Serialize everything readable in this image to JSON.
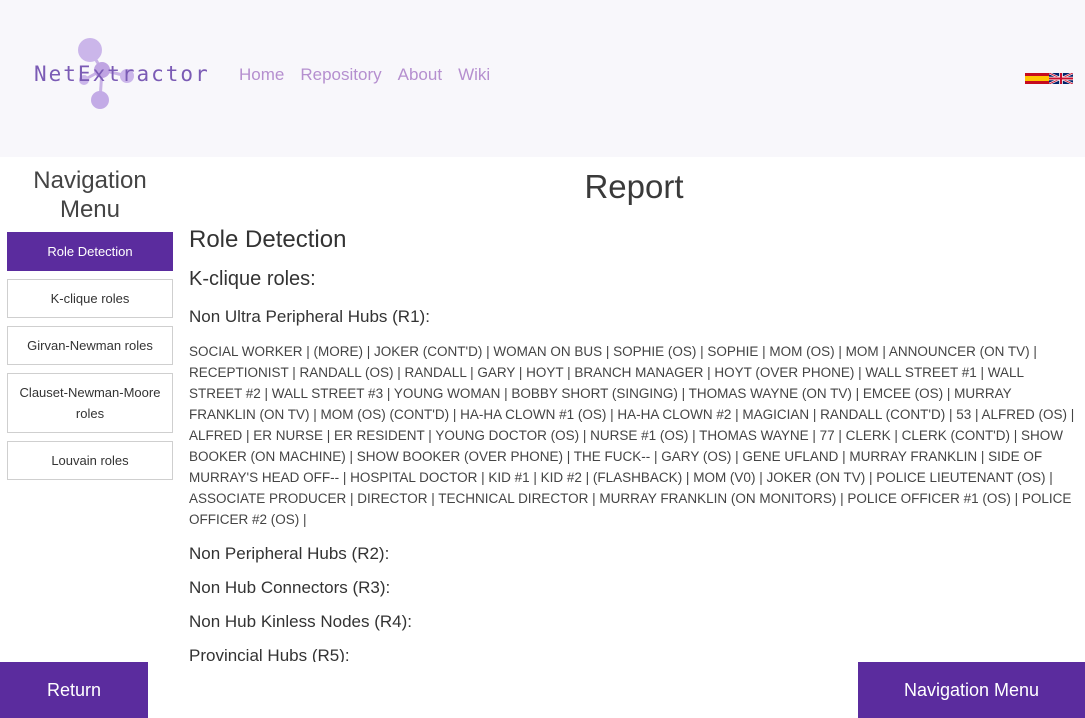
{
  "brand": {
    "name": "NetExtractor"
  },
  "nav": {
    "home": "Home",
    "repository": "Repository",
    "about": "About",
    "wiki": "Wiki"
  },
  "sidebar": {
    "title": "Navigation Menu",
    "items": [
      {
        "label": "Role Detection"
      },
      {
        "label": "K-clique roles"
      },
      {
        "label": "Girvan-Newman roles"
      },
      {
        "label": "Clauset-Newman-Moore roles"
      },
      {
        "label": "Louvain roles"
      }
    ]
  },
  "main": {
    "title": "Report",
    "section": "Role Detection",
    "subsection": "K-clique roles:",
    "roles": [
      {
        "heading": "Non Ultra Peripheral Hubs (R1):",
        "names": "SOCIAL WORKER | (MORE) | JOKER (CONT'D) | WOMAN ON BUS | SOPHIE (OS) | SOPHIE | MOM (OS) | MOM | ANNOUNCER (ON TV) | RECEPTIONIST | RANDALL (OS) | RANDALL | GARY | HOYT | BRANCH MANAGER | HOYT (OVER PHONE) | WALL STREET #1 | WALL STREET #2 | WALL STREET #3 | YOUNG WOMAN | BOBBY SHORT (SINGING) | THOMAS WAYNE (ON TV) | EMCEE (OS) | MURRAY FRANKLIN (ON TV) | MOM (OS) (CONT'D) | HA-HA CLOWN #1 (OS) | HA-HA CLOWN #2 | MAGICIAN | RANDALL (CONT'D) | 53 | ALFRED (OS) | ALFRED | ER NURSE | ER RESIDENT | YOUNG DOCTOR (OS) | NURSE #1 (OS) | THOMAS WAYNE | 77 | CLERK | CLERK (CONT'D) | SHOW BOOKER (ON MACHINE) | SHOW BOOKER (OVER PHONE) | THE FUCK-- | GARY (OS) | GENE UFLAND | MURRAY FRANKLIN | SIDE OF MURRAY'S HEAD OFF-- | HOSPITAL DOCTOR | KID #1 | KID #2 | (FLASHBACK) | MOM (V0) | JOKER (ON TV) | POLICE LIEUTENANT (OS) | ASSOCIATE PRODUCER | DIRECTOR | TECHNICAL DIRECTOR | MURRAY FRANKLIN (ON MONITORS) | POLICE OFFICER #1 (OS) | POLICE OFFICER #2 (OS) |"
      },
      {
        "heading": "Non Peripheral Hubs (R2):"
      },
      {
        "heading": "Non Hub Connectors (R3):"
      },
      {
        "heading": "Non Hub Kinless Nodes (R4):"
      },
      {
        "heading": "Provincial Hubs (R5):"
      }
    ]
  },
  "footer": {
    "return_label": "Return",
    "nav_menu_label": "Navigation Menu"
  },
  "colors": {
    "accent": "#5b2c9e",
    "nav_link": "#b58fcf",
    "header_bg": "#f8f7fb"
  },
  "icons": {
    "flag_es": "spanish-flag-icon",
    "flag_en": "english-flag-icon"
  }
}
